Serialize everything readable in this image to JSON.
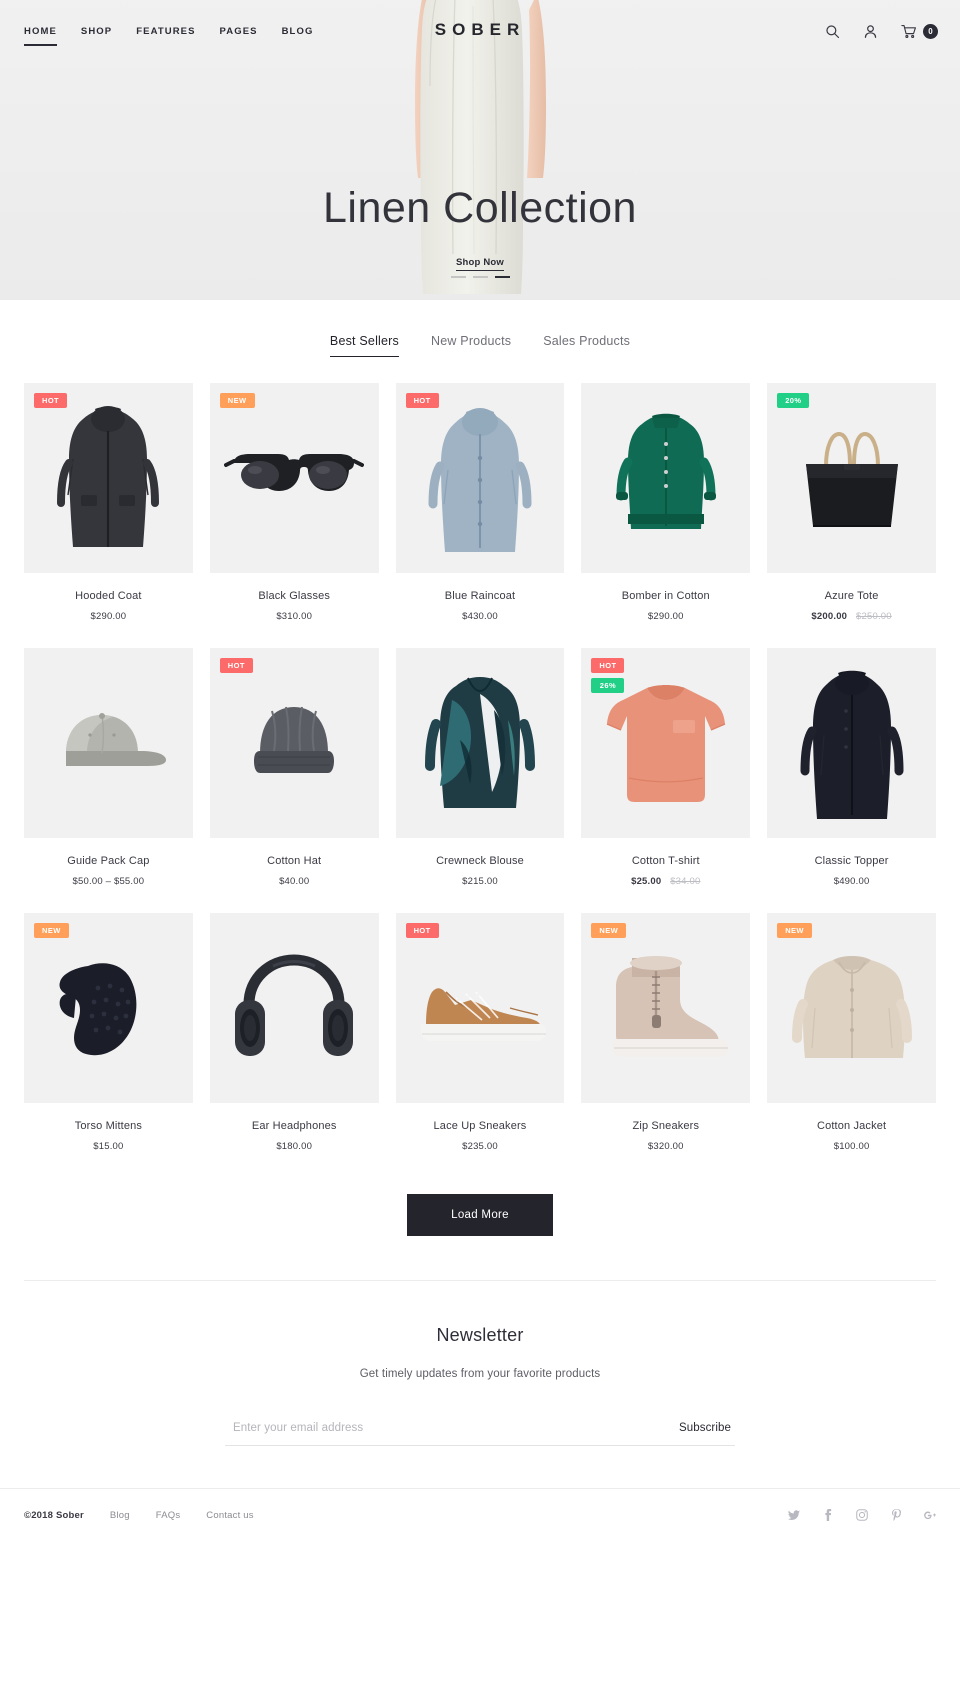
{
  "header": {
    "logo": "SOBER",
    "nav": [
      {
        "label": "HOME",
        "active": true
      },
      {
        "label": "SHOP",
        "active": false
      },
      {
        "label": "FEATURES",
        "active": false
      },
      {
        "label": "PAGES",
        "active": false
      },
      {
        "label": "BLOG",
        "active": false
      }
    ],
    "icons": {
      "search": "search-icon",
      "account": "user-icon",
      "cart": "cart-icon"
    },
    "cart_count": "0"
  },
  "hero": {
    "title": "Linen Collection",
    "cta": "Shop Now",
    "slides": 3,
    "active_slide": 2,
    "bg_color": "#f0f0f0"
  },
  "tabs": [
    {
      "label": "Best Sellers",
      "active": true
    },
    {
      "label": "New Products",
      "active": false
    },
    {
      "label": "Sales Products",
      "active": false
    }
  ],
  "products": [
    {
      "name": "Hooded Coat",
      "price": "$290.00",
      "old": "",
      "badge": "HOT",
      "badge2": "",
      "icon": "coat-dark"
    },
    {
      "name": "Black Glasses",
      "price": "$310.00",
      "old": "",
      "badge": "NEW",
      "badge2": "",
      "icon": "glasses"
    },
    {
      "name": "Blue Raincoat",
      "price": "$430.00",
      "old": "",
      "badge": "HOT",
      "badge2": "",
      "icon": "raincoat"
    },
    {
      "name": "Bomber in Cotton",
      "price": "$290.00",
      "old": "",
      "badge": "",
      "badge2": "",
      "icon": "bomber"
    },
    {
      "name": "Azure Tote",
      "price": "$200.00",
      "old": "$250.00",
      "badge": "20%",
      "badge2": "",
      "icon": "tote"
    },
    {
      "name": "Guide Pack Cap",
      "price": "$50.00 – $55.00",
      "old": "",
      "badge": "",
      "badge2": "",
      "icon": "cap"
    },
    {
      "name": "Cotton Hat",
      "price": "$40.00",
      "old": "",
      "badge": "HOT",
      "badge2": "",
      "icon": "beanie"
    },
    {
      "name": "Crewneck Blouse",
      "price": "$215.00",
      "old": "",
      "badge": "",
      "badge2": "",
      "icon": "blouse"
    },
    {
      "name": "Cotton T-shirt",
      "price": "$25.00",
      "old": "$34.00",
      "badge": "HOT",
      "badge2": "26%",
      "icon": "tshirt"
    },
    {
      "name": "Classic Topper",
      "price": "$490.00",
      "old": "",
      "badge": "",
      "badge2": "",
      "icon": "topper"
    },
    {
      "name": "Torso Mittens",
      "price": "$15.00",
      "old": "",
      "badge": "NEW",
      "badge2": "",
      "icon": "mitten"
    },
    {
      "name": "Ear Headphones",
      "price": "$180.00",
      "old": "",
      "badge": "",
      "badge2": "",
      "icon": "headphones"
    },
    {
      "name": "Lace Up Sneakers",
      "price": "$235.00",
      "old": "",
      "badge": "HOT",
      "badge2": "",
      "icon": "sneaker"
    },
    {
      "name": "Zip Sneakers",
      "price": "$320.00",
      "old": "",
      "badge": "NEW",
      "badge2": "",
      "icon": "zipboot"
    },
    {
      "name": "Cotton Jacket",
      "price": "$100.00",
      "old": "",
      "badge": "NEW",
      "badge2": "",
      "icon": "jacket"
    }
  ],
  "load_more": "Load More",
  "newsletter": {
    "title": "Newsletter",
    "subtitle": "Get timely updates from your favorite products",
    "placeholder": "Enter your email address",
    "value": "",
    "button": "Subscribe"
  },
  "footer": {
    "copyright": "©2018 Sober",
    "links": [
      "Blog",
      "FAQs",
      "Contact us"
    ],
    "socials": [
      "twitter-icon",
      "facebook-icon",
      "instagram-icon",
      "pinterest-icon",
      "google-plus-icon"
    ]
  },
  "colors": {
    "hot": "#fd6a6a",
    "new": "#ff9f5a",
    "sale": "#21d086",
    "dark": "#24242c"
  }
}
